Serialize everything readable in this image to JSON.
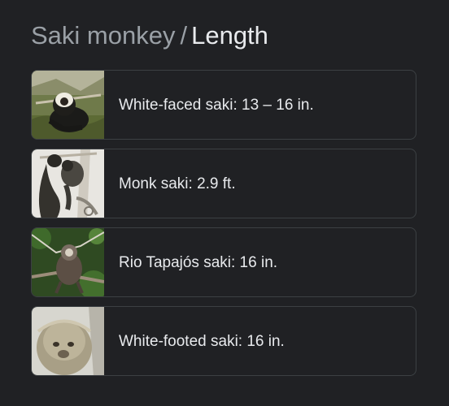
{
  "header": {
    "crumb": "Saki monkey",
    "separator": "/",
    "current": "Length"
  },
  "items": [
    {
      "label": "White-faced saki: 13 – 16 in."
    },
    {
      "label": "Monk saki: 2.9 ft."
    },
    {
      "label": "Rio Tapajós saki: 16 in."
    },
    {
      "label": "White-footed saki: 16 in."
    }
  ]
}
